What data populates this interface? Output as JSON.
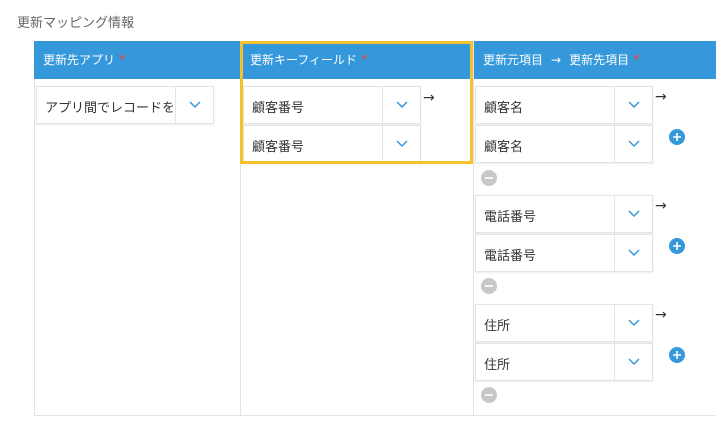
{
  "section_title": "更新マッピング情報",
  "headers": {
    "dest_app": "更新先アプリ",
    "key_field": "更新キーフィールド",
    "source_item": "更新元項目",
    "arrow": "→",
    "dest_item": "更新先項目",
    "required_mark": "*"
  },
  "dest_app": {
    "value": "アプリ間でレコードを"
  },
  "key_fields": [
    "顧客番号",
    "顧客番号"
  ],
  "arrow_symbol": "→",
  "mapping_rows": [
    {
      "source": "顧客名",
      "dest": "顧客名"
    },
    {
      "source": "電話番号",
      "dest": "電話番号"
    },
    {
      "source": "住所",
      "dest": "住所"
    }
  ],
  "icons": {
    "dropdown": "chevron-down-icon",
    "add": "plus-icon",
    "remove": "minus-icon"
  },
  "colors": {
    "header_bg": "#3498db",
    "required": "#e74c3c",
    "highlight": "#f5c22f",
    "add_button": "#3498db",
    "remove_button": "#c8c8c8"
  }
}
